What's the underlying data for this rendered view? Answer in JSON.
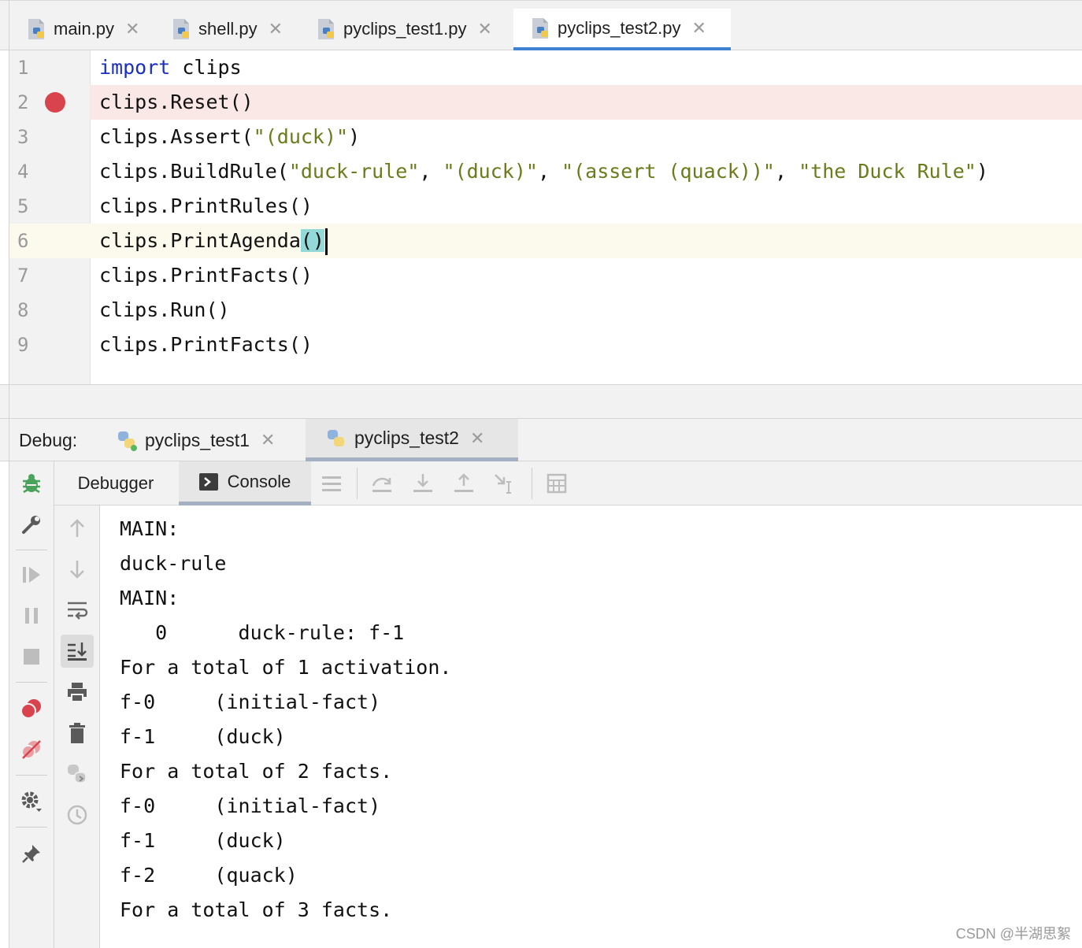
{
  "editor_tabs": [
    {
      "label": "main.py",
      "active": false
    },
    {
      "label": "shell.py",
      "active": false
    },
    {
      "label": "pyclips_test1.py",
      "active": false
    },
    {
      "label": "pyclips_test2.py",
      "active": true
    }
  ],
  "editor": {
    "breakpoint_line": 2,
    "current_line": 6,
    "lines": [
      {
        "num": "1",
        "kw": "import",
        "rest": " clips"
      },
      {
        "num": "2",
        "text": "clips.Reset()"
      },
      {
        "num": "3",
        "pre": "clips.Assert(",
        "s1": "\"(duck)\"",
        "post": ")"
      },
      {
        "num": "4",
        "pre": "clips.BuildRule(",
        "s1": "\"duck-rule\"",
        "c1": ", ",
        "s2": "\"(duck)\"",
        "c2": ", ",
        "s3": "\"(assert (quack))\"",
        "c3": ", ",
        "s4": "\"the Duck Rule\"",
        "post": ")"
      },
      {
        "num": "5",
        "text": "clips.PrintRules()"
      },
      {
        "num": "6",
        "pre": "clips.PrintAgenda",
        "brace": "()"
      },
      {
        "num": "7",
        "text": "clips.PrintFacts()"
      },
      {
        "num": "8",
        "text": "clips.Run()"
      },
      {
        "num": "9",
        "text": "clips.PrintFacts()"
      }
    ]
  },
  "debug": {
    "label": "Debug:",
    "sessions": [
      {
        "label": "pyclips_test1",
        "active": false
      },
      {
        "label": "pyclips_test2",
        "active": true
      }
    ],
    "tabs": {
      "debugger": "Debugger",
      "console": "Console"
    }
  },
  "console_output": [
    "MAIN:",
    "duck-rule",
    "MAIN:",
    "   0      duck-rule: f-1",
    "For a total of 1 activation.",
    "f-0     (initial-fact)",
    "f-1     (duck)",
    "For a total of 2 facts.",
    "f-0     (initial-fact)",
    "f-1     (duck)",
    "f-2     (quack)",
    "For a total of 3 facts."
  ],
  "watermark": "CSDN @半湖思絮",
  "colors": {
    "accent": "#3f82d4",
    "breakpoint": "#d9434d",
    "keyword": "#1a2ec4",
    "string": "#6c7a1c",
    "bug_green": "#4aa35a"
  }
}
